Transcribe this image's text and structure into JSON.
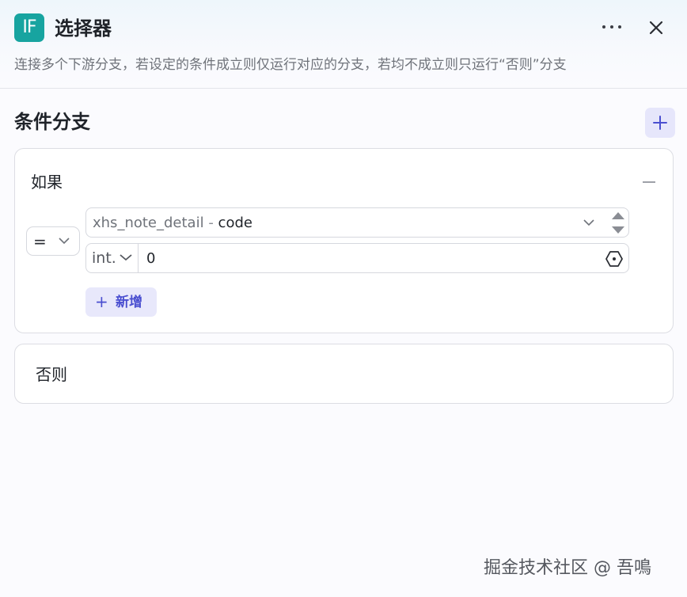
{
  "header": {
    "logo_text": "IF",
    "title": "选择器",
    "description": "连接多个下游分支，若设定的条件成立则仅运行对应的分支，若均不成立则只运行“否则”分支",
    "more_icon": "more-horizontal-icon",
    "close_icon": "close-icon"
  },
  "section": {
    "title": "条件分支",
    "add_icon": "plus-icon"
  },
  "if_branch": {
    "label": "如果",
    "collapse_icon": "minus-icon",
    "operator": "=",
    "variable": {
      "node": "xhs_note_detail",
      "separator": " - ",
      "field": "code"
    },
    "value_type": "int.",
    "value": "0",
    "add_condition_label": "新增"
  },
  "else_branch": {
    "label": "否则"
  },
  "watermark": "掘金技术社区 @ 吾鳴",
  "colors": {
    "logo_bg": "#17a4a0",
    "accent": "#4a4fd0",
    "accent_bg": "#e8e8fb"
  }
}
